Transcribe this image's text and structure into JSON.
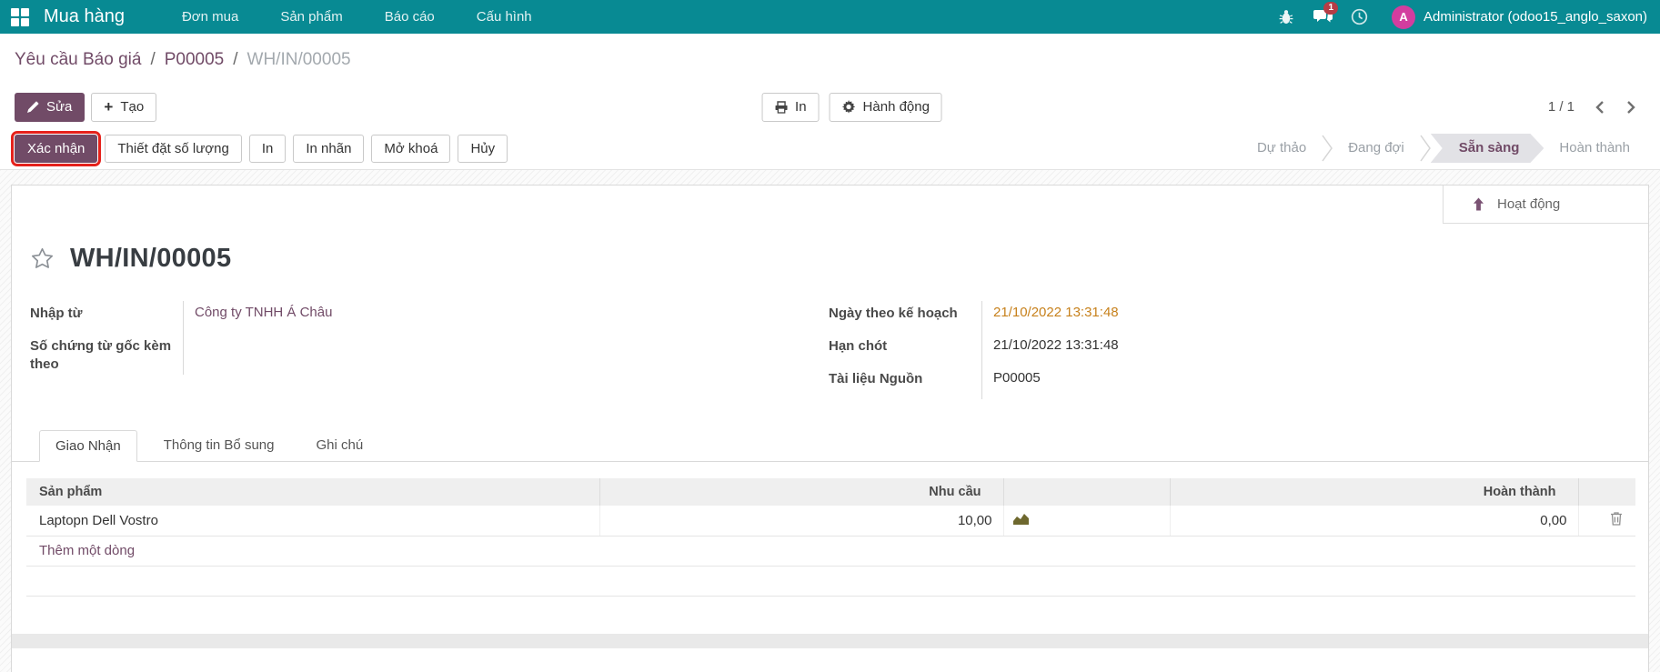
{
  "topbar": {
    "app_name": "Mua hàng",
    "menus": [
      "Đơn mua",
      "Sản phẩm",
      "Báo cáo",
      "Cấu hình"
    ],
    "message_badge": "1",
    "avatar_letter": "A",
    "user": "Administrator (odoo15_anglo_saxon)"
  },
  "breadcrumb": {
    "separator": "/",
    "links": [
      "Yêu cầu Báo giá",
      "P00005"
    ],
    "current": "WH/IN/00005"
  },
  "control_panel": {
    "edit_label": "Sửa",
    "create_label": "Tạo",
    "print_label": "In",
    "action_label": "Hành động",
    "pager": "1 / 1"
  },
  "statusbar": {
    "buttons": [
      {
        "label": "Xác nhận"
      },
      {
        "label": "Thiết đặt số lượng"
      },
      {
        "label": "In"
      },
      {
        "label": "In nhãn"
      },
      {
        "label": "Mở khoá"
      },
      {
        "label": "Hủy"
      }
    ],
    "stages": [
      {
        "label": "Dự thảo"
      },
      {
        "label": "Đang đợi"
      },
      {
        "label": "Sẵn sàng",
        "active": true
      },
      {
        "label": "Hoàn thành"
      }
    ]
  },
  "chatter": {
    "activity_label": "Hoạt động"
  },
  "form": {
    "title": "WH/IN/00005",
    "fields_left": [
      {
        "label": "Nhập từ",
        "value": "Công ty TNHH Á Châu"
      },
      {
        "label": "Số chứng từ gốc kèm theo",
        "value": ""
      }
    ],
    "fields_right": [
      {
        "label": "Ngày theo kế hoạch",
        "value": "21/10/2022 13:31:48"
      },
      {
        "label": "Hạn chót",
        "value": "21/10/2022 13:31:48"
      },
      {
        "label": "Tài liệu Nguồn",
        "value": "P00005"
      }
    ],
    "tabs": [
      {
        "label": "Giao Nhận",
        "active": true
      },
      {
        "label": "Thông tin Bổ sung"
      },
      {
        "label": "Ghi chú"
      }
    ],
    "table": {
      "headers": {
        "product": "Sản phẩm",
        "demand": "Nhu cầu",
        "done": "Hoàn thành"
      },
      "rows": [
        {
          "product": "Laptopn Dell Vostro",
          "demand": "10,00",
          "done": "0,00"
        }
      ],
      "add_line_label": "Thêm một dòng"
    }
  },
  "colors": {
    "topbar_bg": "#088a93",
    "brand_purple": "#714B67",
    "warning_text": "#c7811c",
    "annotation_red": "#e5211b",
    "avatar_bg": "#d23d9f",
    "badge_bg": "#b43c46",
    "stage_active_bg": "#e2e2e6"
  }
}
